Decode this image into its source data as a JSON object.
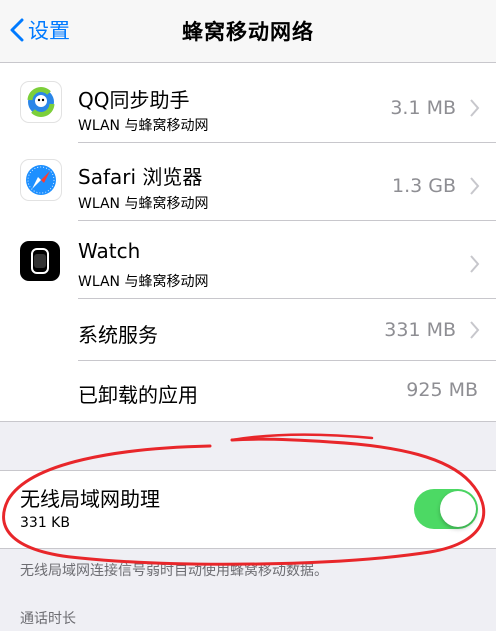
{
  "nav": {
    "back_label": "设置",
    "title": "蜂窝移动网络"
  },
  "apps": [
    {
      "name": "QQ同步助手",
      "subtitle": "WLAN 与蜂窝移动网",
      "value": "3.1 MB",
      "icon": "qq-sync-icon"
    },
    {
      "name": "Safari 浏览器",
      "subtitle": "WLAN 与蜂窝移动网",
      "value": "1.3 GB",
      "icon": "safari-icon"
    },
    {
      "name": "Watch",
      "subtitle": "WLAN 与蜂窝移动网",
      "value": "",
      "icon": "watch-icon"
    }
  ],
  "system_services": {
    "label": "系统服务",
    "value": "331 MB"
  },
  "uninstalled_apps": {
    "label": "已卸载的应用",
    "value": "925 MB"
  },
  "wifi_assist": {
    "label": "无线局域网助理",
    "size": "331 KB",
    "enabled": true,
    "footnote": "无线局域网连接信号弱时自动使用蜂窝移动数据。"
  },
  "call_time_header": "通话时长",
  "colors": {
    "accent": "#007aff",
    "toggle_on": "#4cd964",
    "annotation": "#e8262a"
  }
}
